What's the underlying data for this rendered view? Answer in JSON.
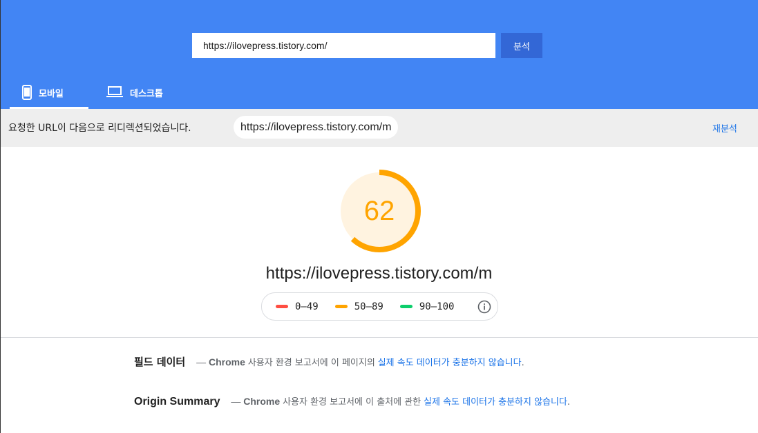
{
  "search": {
    "url_value": "https://ilovepress.tistory.com/",
    "analyze_label": "분석"
  },
  "tabs": [
    {
      "label": "모바일",
      "icon": "smartphone-icon",
      "active": true
    },
    {
      "label": "데스크톱",
      "icon": "laptop-icon",
      "active": false
    }
  ],
  "redirect": {
    "message": "요청한 URL이 다음으로 리디렉션되었습니다.",
    "final_url": "https://ilovepress.tistory.com/m",
    "reanalyze_label": "재분석"
  },
  "score": {
    "value": "62",
    "fraction": 0.62,
    "color": "#ffa400",
    "track_color": "#fff3e0"
  },
  "final_url": "https://ilovepress.tistory.com/m",
  "legend": [
    {
      "range": "0–49",
      "color": "#ff4e42"
    },
    {
      "range": "50–89",
      "color": "#ffa400"
    },
    {
      "range": "90–100",
      "color": "#0cce6b"
    }
  ],
  "field_data": {
    "title": "필드 데이터",
    "dash": "—",
    "chrome": "Chrome",
    "text": "사용자 환경 보고서에 이 페이지의",
    "link": "실제 속도 데이터가 충분하지 않습니다",
    "end": "."
  },
  "origin_summary": {
    "title": "Origin Summary",
    "dash": "—",
    "chrome": "Chrome",
    "text": "사용자 환경 보고서에 이 출처에 관한",
    "link": "실제 속도 데이터가 충분하지 않습니다",
    "end": "."
  },
  "colors": {
    "header": "#4285f4",
    "button": "#3367d6",
    "link": "#1a73e8"
  }
}
